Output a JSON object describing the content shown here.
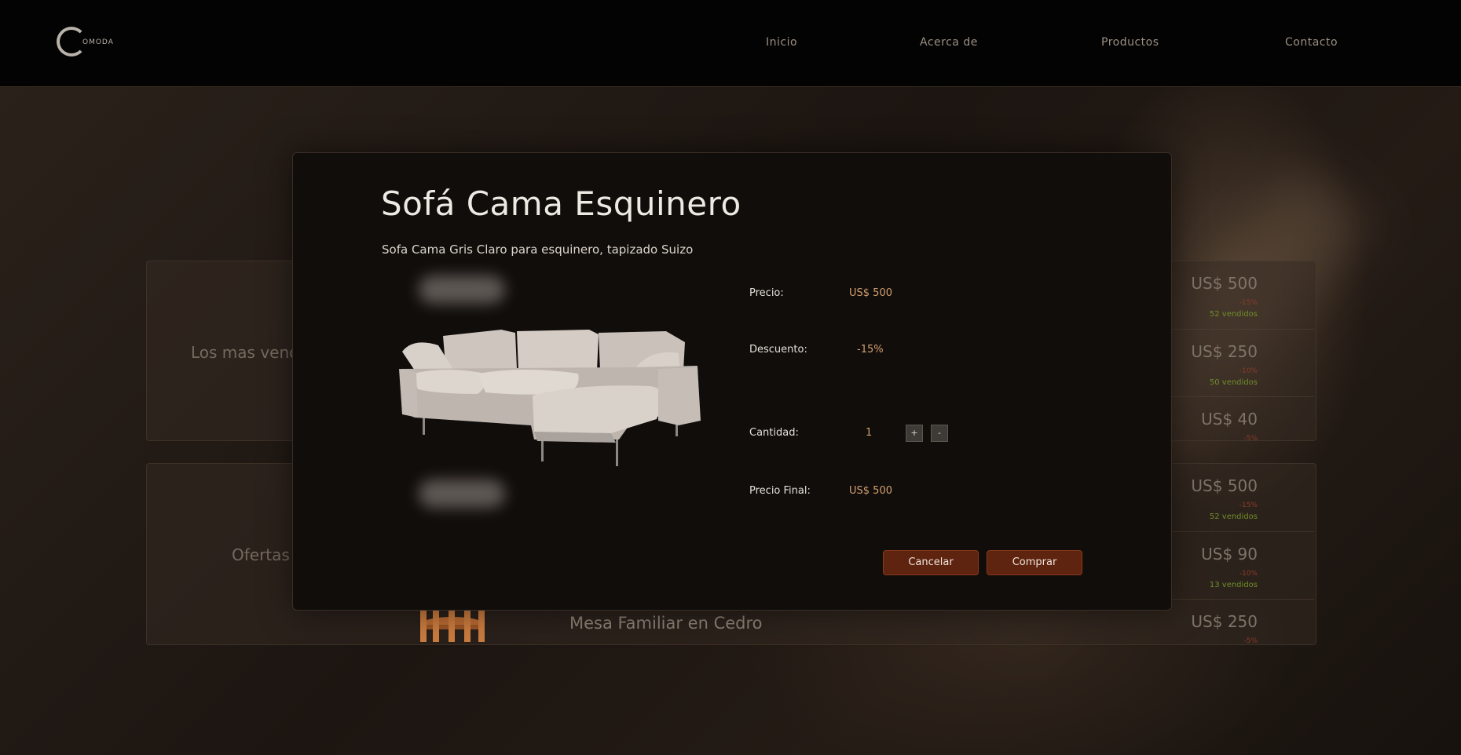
{
  "header": {
    "logo_letter": "C",
    "logo_text": "OMODA",
    "nav": [
      "Inicio",
      "Acerca de",
      "Productos",
      "Contacto"
    ]
  },
  "background": {
    "sections": [
      {
        "title": "Los mas vendidos",
        "rows": [
          {
            "price": "US$ 500",
            "discount": "-15%",
            "sold": "52 vendidos"
          },
          {
            "price": "US$ 250",
            "discount": "-10%",
            "sold": "50 vendidos"
          },
          {
            "price": "US$ 40",
            "discount": "-5%",
            "sold": ""
          }
        ]
      },
      {
        "title": "Ofertas",
        "rows": [
          {
            "name": "",
            "price": "US$ 500",
            "discount": "-15%",
            "sold": "52 vendidos"
          },
          {
            "name": "",
            "price": "US$ 90",
            "discount": "-10%",
            "sold": "13 vendidos"
          },
          {
            "name": "Mesa Familiar en Cedro",
            "price": "US$ 250",
            "discount": "-5%",
            "sold": ""
          }
        ]
      }
    ]
  },
  "modal": {
    "title": "Sofá Cama Esquinero",
    "description": "Sofa Cama Gris Claro para esquinero, tapizado Suizo",
    "price_label": "Precio:",
    "price_value": "US$ 500",
    "discount_label": "Descuento:",
    "discount_value": "-15%",
    "quantity_label": "Cantidad:",
    "quantity_value": "1",
    "plus_label": "+",
    "minus_label": "-",
    "final_label": "Precio Final:",
    "final_value": "US$ 500",
    "cancel_label": "Cancelar",
    "buy_label": "Comprar"
  },
  "colors": {
    "accent_price": "#d3a06f",
    "button_bg": "#5e2410",
    "sold_green": "#9acd32",
    "discount_red": "#c0392b"
  }
}
